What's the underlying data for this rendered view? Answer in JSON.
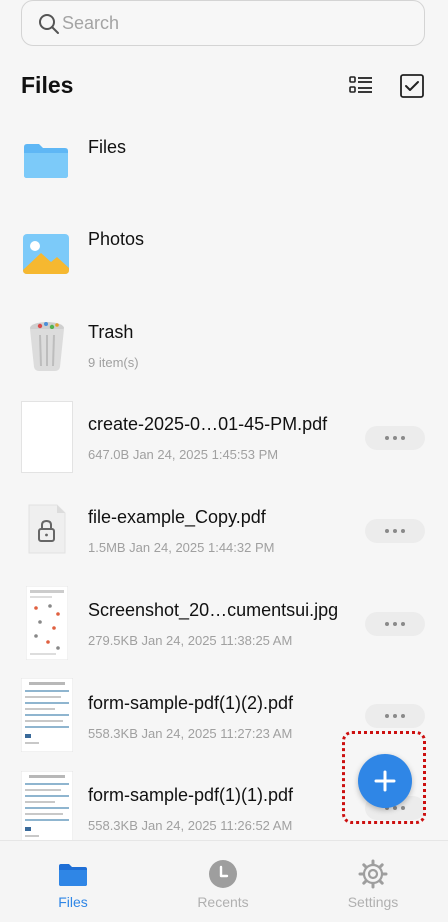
{
  "search": {
    "placeholder": "Search"
  },
  "header": {
    "title": "Files"
  },
  "items": [
    {
      "name": "Files",
      "meta": ""
    },
    {
      "name": "Photos",
      "meta": ""
    },
    {
      "name": "Trash",
      "meta": "9 item(s)"
    },
    {
      "name": "create-2025-0…01-45-PM.pdf",
      "meta": "647.0B Jan 24, 2025 1:45:53 PM"
    },
    {
      "name": "file-example_Copy.pdf",
      "meta": "1.5MB Jan 24, 2025 1:44:32 PM"
    },
    {
      "name": "Screenshot_20…cumentsui.jpg",
      "meta": "279.5KB Jan 24, 2025 11:38:25 AM"
    },
    {
      "name": "form-sample-pdf(1)(2).pdf",
      "meta": "558.3KB Jan 24, 2025 11:27:23 AM"
    },
    {
      "name": "form-sample-pdf(1)(1).pdf",
      "meta": "558.3KB Jan 24, 2025 11:26:52 AM"
    }
  ],
  "nav": {
    "files": "Files",
    "recents": "Recents",
    "settings": "Settings"
  },
  "colors": {
    "accent": "#2f86e6",
    "highlight_border": "#cc1010",
    "inactive": "#b0b0b0"
  }
}
